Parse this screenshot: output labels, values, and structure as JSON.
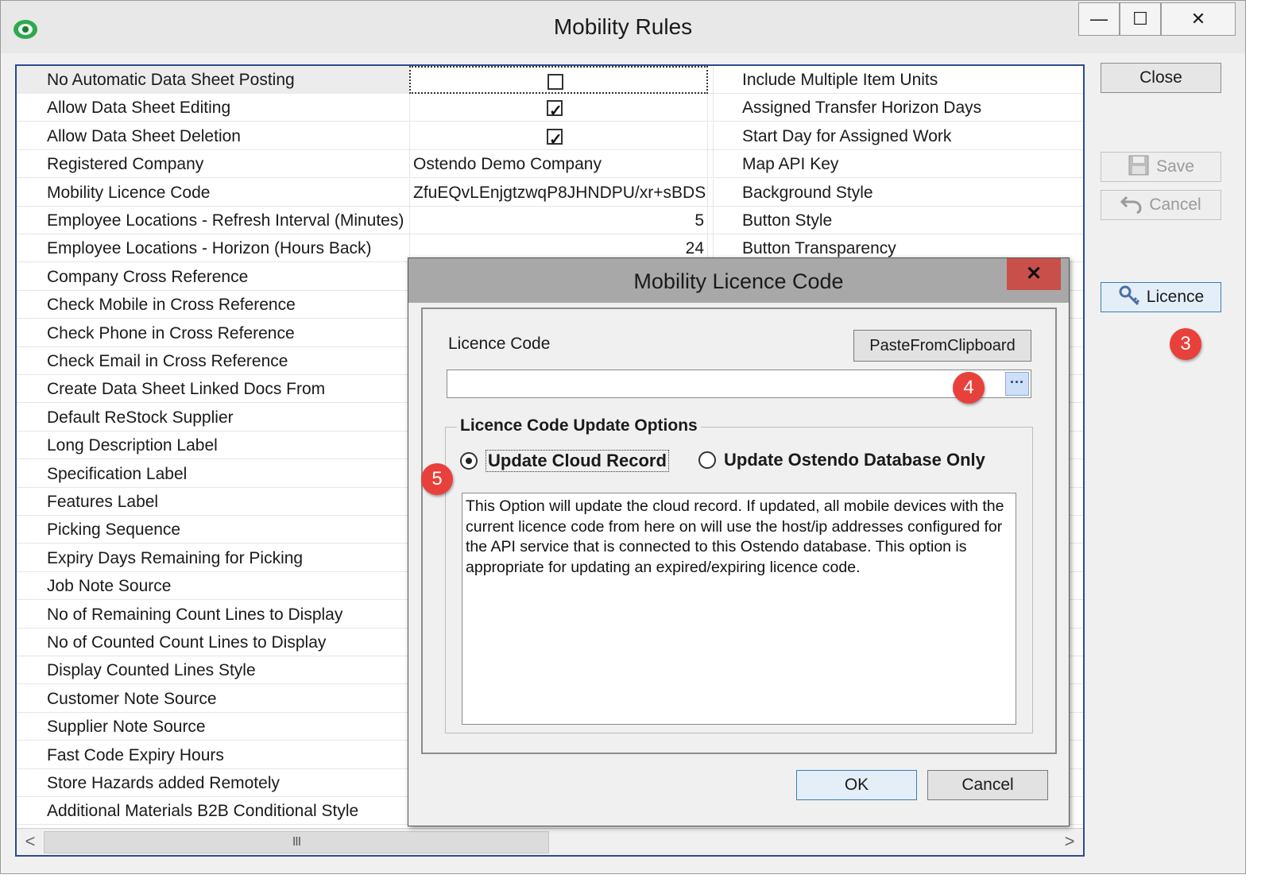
{
  "window": {
    "title": "Mobility Rules",
    "minimize_glyph": "—",
    "maximize_glyph": "☐",
    "close_glyph": "✕",
    "app_icon": "green-eye-icon"
  },
  "grid": {
    "rows": [
      {
        "label": "No Automatic Data Sheet Posting",
        "type": "checkbox",
        "checked": false,
        "right": "Include Multiple Item Units"
      },
      {
        "label": "Allow Data Sheet Editing",
        "type": "checkbox",
        "checked": true,
        "right": "Assigned Transfer Horizon Days"
      },
      {
        "label": "Allow Data Sheet Deletion",
        "type": "checkbox",
        "checked": true,
        "right": "Start Day for Assigned Work"
      },
      {
        "label": "Registered Company",
        "type": "text",
        "value": "Ostendo Demo Company",
        "right": "Map API Key"
      },
      {
        "label": "Mobility Licence Code",
        "type": "text",
        "value": "ZfuEQvLEnjgtzwqP8JHNDPU/xr+sBDS",
        "right": "Background Style"
      },
      {
        "label": "Employee Locations -  Refresh Interval (Minutes)",
        "type": "num",
        "value": "5",
        "right": "Button Style"
      },
      {
        "label": "Employee Locations - Horizon (Hours Back)",
        "type": "num",
        "value": "24",
        "right": "Button Transparency"
      },
      {
        "label": "Company Cross Reference",
        "type": "text",
        "value": "",
        "right": ""
      },
      {
        "label": "Check Mobile in Cross Reference",
        "type": "text",
        "value": "",
        "right": ""
      },
      {
        "label": "Check Phone in Cross Reference",
        "type": "text",
        "value": "",
        "right": ""
      },
      {
        "label": "Check Email in Cross Reference",
        "type": "text",
        "value": "",
        "right": ""
      },
      {
        "label": "Create Data Sheet Linked Docs From",
        "type": "text",
        "value": "",
        "right": ""
      },
      {
        "label": "Default ReStock Supplier",
        "type": "text",
        "value": "",
        "right": ""
      },
      {
        "label": "Long Description Label",
        "type": "text",
        "value": "",
        "right": ""
      },
      {
        "label": "Specification Label",
        "type": "text",
        "value": "",
        "right": ""
      },
      {
        "label": "Features Label",
        "type": "text",
        "value": "",
        "right": ""
      },
      {
        "label": "Picking Sequence",
        "type": "text",
        "value": "",
        "right": ""
      },
      {
        "label": "Expiry Days Remaining for Picking",
        "type": "text",
        "value": "",
        "right": ""
      },
      {
        "label": "Job Note Source",
        "type": "text",
        "value": "",
        "right": ""
      },
      {
        "label": "No of Remaining Count Lines to Display",
        "type": "text",
        "value": "",
        "right": ""
      },
      {
        "label": "No of Counted Count Lines to Display",
        "type": "text",
        "value": "",
        "right": ""
      },
      {
        "label": "Display Counted Lines Style",
        "type": "text",
        "value": "",
        "right": ""
      },
      {
        "label": "Customer Note Source",
        "type": "text",
        "value": "",
        "right": ""
      },
      {
        "label": "Supplier Note Source",
        "type": "text",
        "value": "",
        "right": ""
      },
      {
        "label": "Fast Code Expiry Hours",
        "type": "text",
        "value": "",
        "right": ""
      },
      {
        "label": "Store Hazards added Remotely",
        "type": "text",
        "value": "",
        "right": ""
      },
      {
        "label": "Additional Materials B2B Conditional Style",
        "type": "text",
        "value": "",
        "right": ""
      }
    ],
    "scroll": {
      "left_arrow": "<",
      "right_arrow": ">",
      "grip": "III"
    }
  },
  "sidebar": {
    "close_label": "Close",
    "save_label": "Save",
    "cancel_label": "Cancel",
    "licence_label": "Licence"
  },
  "badges": {
    "b3": "3",
    "b4": "4",
    "b5": "5"
  },
  "dialog": {
    "title": "Mobility Licence Code",
    "close_glyph": "✕",
    "licence_code_label": "Licence Code",
    "paste_label": "PasteFromClipboard",
    "licence_code_value": "",
    "ellipsis_label": "···",
    "group_title": "Licence Code Update Options",
    "option_cloud": "Update Cloud Record",
    "option_db": "Update Ostendo Database Only",
    "selected_option": "cloud",
    "description": "This Option will update the cloud record. If updated, all mobile devices with the current licence code from here on will use the host/ip addresses configured for the API service that is connected to this Ostendo database. This option is appropriate for updating an expired/expiring licence code.",
    "ok_label": "OK",
    "cancel_label": "Cancel"
  },
  "colors": {
    "grid_border": "#2e4a8c",
    "badge": "#e8403a",
    "dialog_close": "#c9504a",
    "default_button": "#3c7fb1"
  }
}
